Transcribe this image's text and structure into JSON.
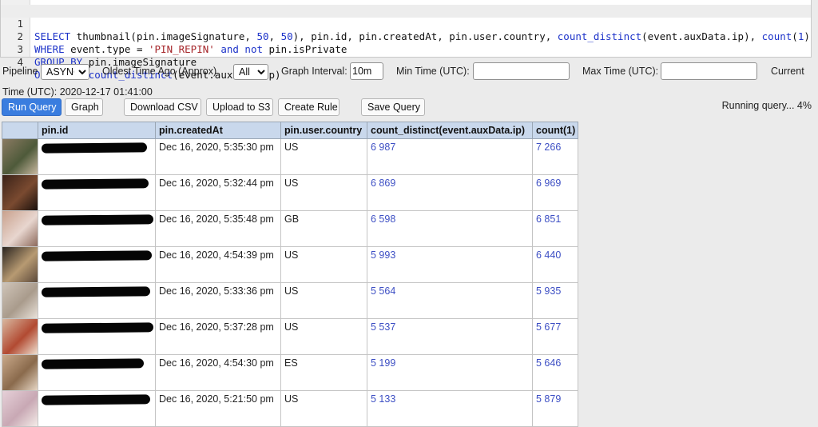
{
  "query": {
    "lines": [
      {
        "number": "1",
        "tokens": [
          {
            "t": "SELECT",
            "c": "kw"
          },
          {
            "t": " thumbnail(pin.imageSignature, ",
            "c": ""
          },
          {
            "t": "50",
            "c": "num"
          },
          {
            "t": ", ",
            "c": ""
          },
          {
            "t": "50",
            "c": "num"
          },
          {
            "t": "), pin.id, pin.createdAt, pin.user.country, ",
            "c": ""
          },
          {
            "t": "count_distinct",
            "c": "kw"
          },
          {
            "t": "(event.auxData.ip), ",
            "c": ""
          },
          {
            "t": "count",
            "c": "kw"
          },
          {
            "t": "(",
            "c": ""
          },
          {
            "t": "1",
            "c": "num"
          },
          {
            "t": ")",
            "c": ""
          }
        ]
      },
      {
        "number": "2",
        "tokens": [
          {
            "t": "WHERE",
            "c": "kw"
          },
          {
            "t": " event.type = ",
            "c": ""
          },
          {
            "t": "'PIN_REPIN'",
            "c": "str"
          },
          {
            "t": " ",
            "c": ""
          },
          {
            "t": "and not",
            "c": "kw"
          },
          {
            "t": " pin.isPrivate",
            "c": ""
          }
        ]
      },
      {
        "number": "3",
        "tokens": [
          {
            "t": "GROUP BY",
            "c": "kw"
          },
          {
            "t": " pin.imageSignature",
            "c": ""
          }
        ]
      },
      {
        "number": "4",
        "tokens": [
          {
            "t": "ORDER BY",
            "c": "kw"
          },
          {
            "t": " ",
            "c": ""
          },
          {
            "t": "count_distinct",
            "c": "kw"
          },
          {
            "t": "(event.auxData.ip)",
            "c": ""
          }
        ]
      }
    ]
  },
  "controls": {
    "pipeline_label": "Pipeline",
    "pipeline_value": "ASYNC",
    "oldest_label": "Oldest Time Ago (Approx)",
    "oldest_value": "All",
    "interval_label": "Graph Interval:",
    "interval_value": "10m",
    "min_time_label": "Min Time (UTC):",
    "min_time_value": "",
    "max_time_label": "Max Time (UTC):",
    "max_time_value": "",
    "current_label": "Current",
    "current_time": "Time (UTC): 2020-12-17 01:41:00"
  },
  "buttons": {
    "run": "Run Query",
    "graph": "Graph",
    "download": "Download CSV",
    "upload": "Upload to S3",
    "create_rule": "Create Rule",
    "save": "Save Query"
  },
  "status": "Running query... 4%",
  "table": {
    "columns": [
      "",
      "pin.id",
      "pin.createdAt",
      "pin.user.country",
      "count_distinct(event.auxData.ip)",
      "count(1)"
    ],
    "rows": [
      {
        "createdAt": "Dec 16, 2020, 5:35:30 pm",
        "country": "US",
        "distinct": "6 987",
        "count": "7 266",
        "thumb": [
          "#8a7a62",
          "#4e5a3a",
          "#c8b8a0"
        ]
      },
      {
        "createdAt": "Dec 16, 2020, 5:32:44 pm",
        "country": "US",
        "distinct": "6 869",
        "count": "6 969",
        "thumb": [
          "#3a2218",
          "#7a4a30",
          "#1a100c"
        ]
      },
      {
        "createdAt": "Dec 16, 2020, 5:35:48 pm",
        "country": "GB",
        "distinct": "6 598",
        "count": "6 851",
        "thumb": [
          "#c9a18d",
          "#e8d6cf",
          "#8d6a5c"
        ]
      },
      {
        "createdAt": "Dec 16, 2020, 4:54:39 pm",
        "country": "US",
        "distinct": "5 993",
        "count": "6 440",
        "thumb": [
          "#2a2420",
          "#b79a72",
          "#5c4a3a"
        ]
      },
      {
        "createdAt": "Dec 16, 2020, 5:33:36 pm",
        "country": "US",
        "distinct": "5 564",
        "count": "5 935",
        "thumb": [
          "#cfc4b8",
          "#a99b8c",
          "#e9e2da"
        ]
      },
      {
        "createdAt": "Dec 16, 2020, 5:37:28 pm",
        "country": "US",
        "distinct": "5 537",
        "count": "5 677",
        "thumb": [
          "#d8b8a0",
          "#b24a32",
          "#efe0d0"
        ]
      },
      {
        "createdAt": "Dec 16, 2020, 4:54:30 pm",
        "country": "ES",
        "distinct": "5 199",
        "count": "5 646",
        "thumb": [
          "#c9a98a",
          "#8a6a4c",
          "#e6d6c4"
        ]
      },
      {
        "createdAt": "Dec 16, 2020, 5:21:50 pm",
        "country": "US",
        "distinct": "5 133",
        "count": "5 879",
        "thumb": [
          "#e6d0d8",
          "#c8a8b4",
          "#f4ece8"
        ]
      }
    ]
  }
}
